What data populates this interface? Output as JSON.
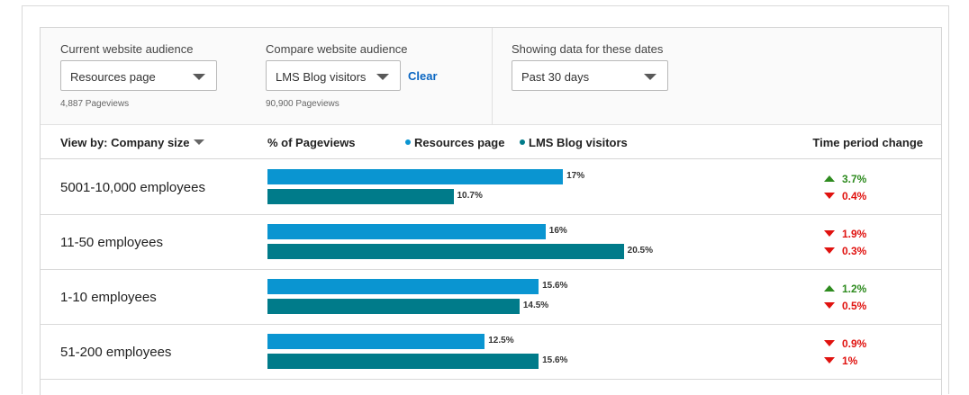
{
  "colors": {
    "resources_page": "#0a95d1",
    "lms_blog": "#007b8a",
    "increase": "#2e8b1f",
    "decrease": "#e0120f",
    "link": "#0a66c2"
  },
  "filters": {
    "current": {
      "label": "Current website audience",
      "value": "Resources page",
      "sub": "4,887 Pageviews"
    },
    "compare": {
      "label": "Compare website audience",
      "value": "LMS Blog visitors",
      "sub": "90,900 Pageviews",
      "clear_label": "Clear"
    },
    "dates": {
      "label": "Showing data for these dates",
      "value": "Past 30 days"
    }
  },
  "header": {
    "view_by": "View by: Company size",
    "metric": "% of Pageviews",
    "legend": [
      "Resources page",
      "LMS Blog visitors"
    ],
    "time_period_change": "Time period change"
  },
  "chart_data": {
    "type": "bar",
    "orientation": "horizontal",
    "categories": [
      "5001-10,000 employees",
      "11-50 employees",
      "1-10 employees",
      "51-200 employees"
    ],
    "series": [
      {
        "name": "Resources page",
        "values": [
          17,
          16,
          15.6,
          12.5
        ],
        "labels": [
          "17%",
          "16%",
          "15.6%",
          "12.5%"
        ]
      },
      {
        "name": "LMS Blog visitors",
        "values": [
          10.7,
          20.5,
          14.5,
          15.6
        ],
        "labels": [
          "10.7%",
          "20.5%",
          "14.5%",
          "15.6%"
        ]
      }
    ]
  },
  "rows": [
    {
      "label": "5001-10,000 employees",
      "changes": [
        {
          "dir": "up",
          "text": "3.7%"
        },
        {
          "dir": "down",
          "text": "0.4%"
        }
      ]
    },
    {
      "label": "11-50 employees",
      "changes": [
        {
          "dir": "down",
          "text": "1.9%"
        },
        {
          "dir": "down",
          "text": "0.3%"
        }
      ]
    },
    {
      "label": "1-10 employees",
      "changes": [
        {
          "dir": "up",
          "text": "1.2%"
        },
        {
          "dir": "down",
          "text": "0.5%"
        }
      ]
    },
    {
      "label": "51-200 employees",
      "changes": [
        {
          "dir": "down",
          "text": "0.9%"
        },
        {
          "dir": "down",
          "text": "1%"
        }
      ]
    }
  ]
}
